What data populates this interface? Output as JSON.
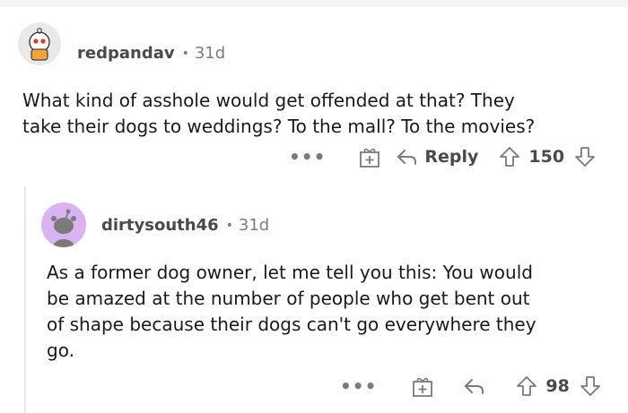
{
  "comments": [
    {
      "username": "redpandav",
      "separator": "•",
      "age": "31d",
      "body_lines": [
        "What kind of asshole would get offended at that? They",
        "take their dogs to weddings? To the mall? To the movies?"
      ],
      "actions": {
        "more": "•••",
        "reply": "Reply",
        "score": "150"
      }
    },
    {
      "username": "dirtysouth46",
      "separator": "•",
      "age": "31d",
      "body_lines": [
        "As a former dog owner, let me tell you this:  You would",
        "be amazed at the number of people who get bent out",
        "of shape because their dogs can't go everywhere they",
        "go."
      ],
      "actions": {
        "more": "•••",
        "score": "98"
      }
    }
  ],
  "colors": {
    "avatar2_bg": "#d9b3f2",
    "avatar1_bg": "#e9e9e9",
    "icon": "#787c7e"
  }
}
